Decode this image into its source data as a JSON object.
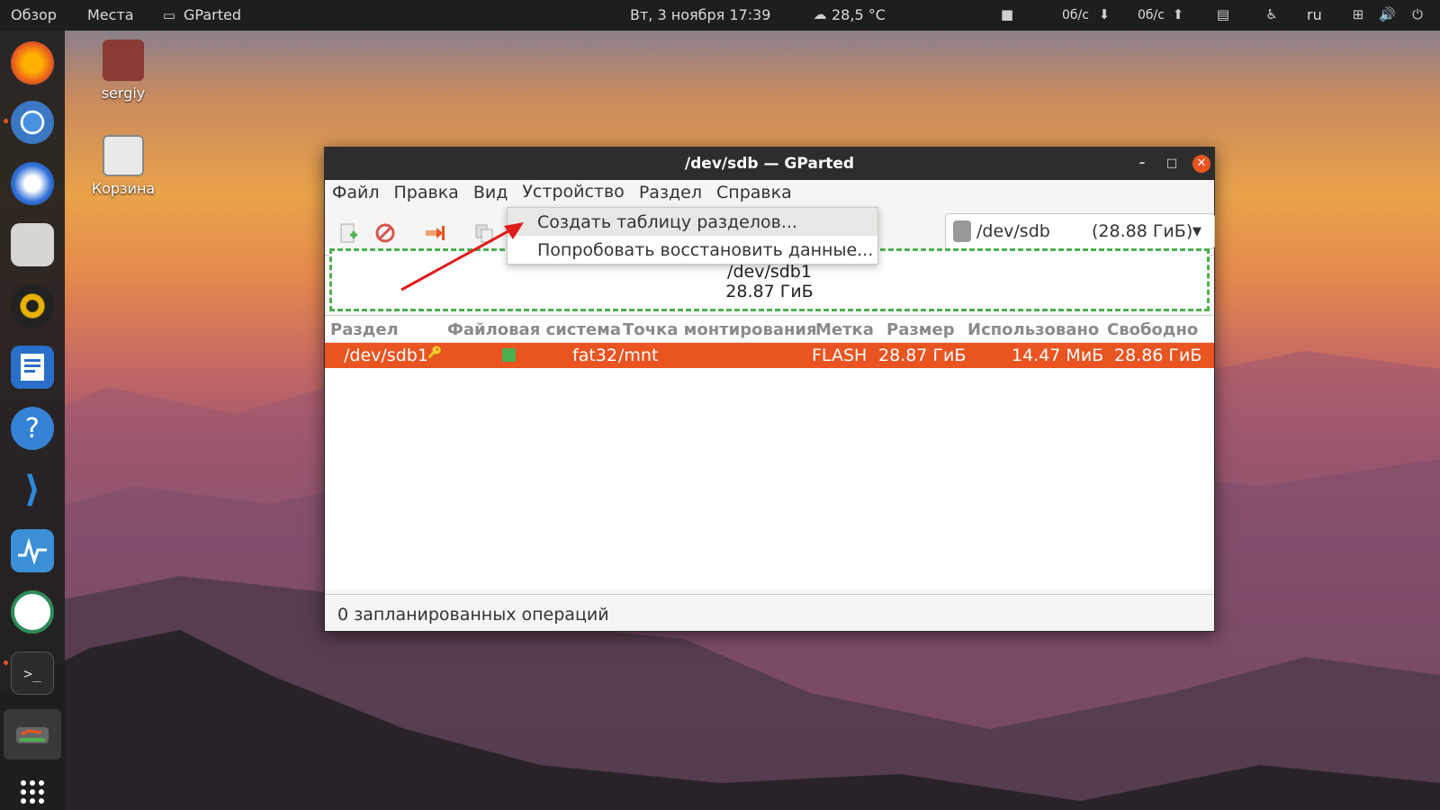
{
  "topbar": {
    "overview": "Обзор",
    "places": "Места",
    "app_name": "GParted",
    "datetime": "Вт, 3 ноября  17:39",
    "weather": "28,5 °C",
    "net_down": "0б/с",
    "net_up": "0б/с",
    "lang": "ru"
  },
  "desktop": {
    "home_label": "sergiy",
    "trash_label": "Корзина"
  },
  "dock": {
    "items": [
      "firefox-icon",
      "chromium-icon",
      "thunderbird-icon",
      "files-icon",
      "rhythmbox-icon",
      "writer-icon",
      "help-icon",
      "vscode-icon",
      "monitor-icon",
      "remmina-icon",
      "terminal-icon",
      "gparted-icon",
      "app-grid-icon"
    ]
  },
  "window": {
    "title": "/dev/sdb — GParted",
    "menu": {
      "file": "Файл",
      "edit": "Правка",
      "view": "Вид",
      "device": "Устройство",
      "partition": "Раздел",
      "help": "Справка"
    },
    "device_selector": {
      "device": "/dev/sdb",
      "size": "(28.88 ГиБ)"
    },
    "partition_map": {
      "name": "/dev/sdb1",
      "size": "28.87 ГиБ"
    },
    "table": {
      "headers": {
        "partition": "Раздел",
        "filesystem": "Файловая система",
        "mountpoint": "Точка монтирования",
        "label": "Метка",
        "size": "Размер",
        "used": "Использовано",
        "free": "Свободно"
      },
      "rows": [
        {
          "partition": "/dev/sdb1",
          "filesystem": "fat32",
          "mountpoint": "/mnt",
          "label": "FLASH",
          "size": "28.87 ГиБ",
          "used": "14.47 МиБ",
          "free": "28.86 ГиБ"
        }
      ]
    },
    "status": "0 запланированных операций"
  },
  "dropdown": {
    "items": [
      "Создать таблицу разделов...",
      "Попробовать восстановить данные..."
    ]
  },
  "colors": {
    "accent": "#e95420",
    "fat32": "#4caf50",
    "topbar": "#1e1e1e"
  },
  "tray": {
    "indicators": [
      "camera-icon",
      "download-icon",
      "upload-icon",
      "clipboard-icon",
      "accessibility-icon",
      "network-icon",
      "volume-icon",
      "power-icon"
    ]
  }
}
